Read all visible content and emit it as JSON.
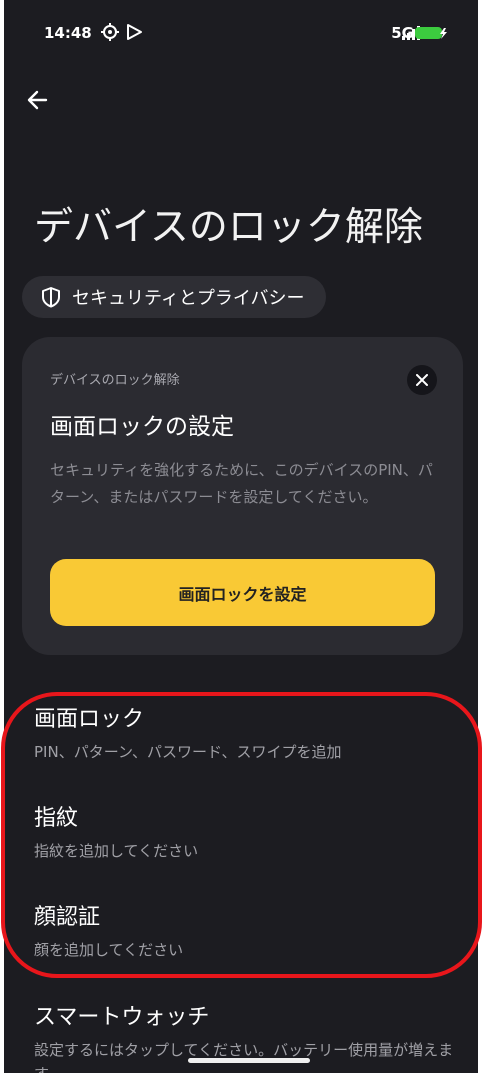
{
  "status_bar": {
    "time": "14:48",
    "network": "5G"
  },
  "page": {
    "title": "デバイスのロック解除",
    "chip_label": "セキュリティとプライバシー"
  },
  "card": {
    "caption": "デバイスのロック解除",
    "title": "画面ロックの設定",
    "description": "セキュリティを強化するために、このデバイスのPIN、パターン、またはパスワードを設定してください。",
    "button_label": "画面ロックを設定"
  },
  "items": [
    {
      "title": "画面ロック",
      "subtitle": "PIN、パターン、パスワード、スワイプを追加"
    },
    {
      "title": "指紋",
      "subtitle": "指紋を追加してください"
    },
    {
      "title": "顔認証",
      "subtitle": "顔を追加してください"
    },
    {
      "title": "スマートウォッチ",
      "subtitle": "設定するにはタップしてください。バッテリー使用量が増えます"
    }
  ],
  "colors": {
    "background": "#1c1c21",
    "card": "#2b2b31",
    "accent_button": "#f9c935",
    "highlight": "#e8161b"
  }
}
